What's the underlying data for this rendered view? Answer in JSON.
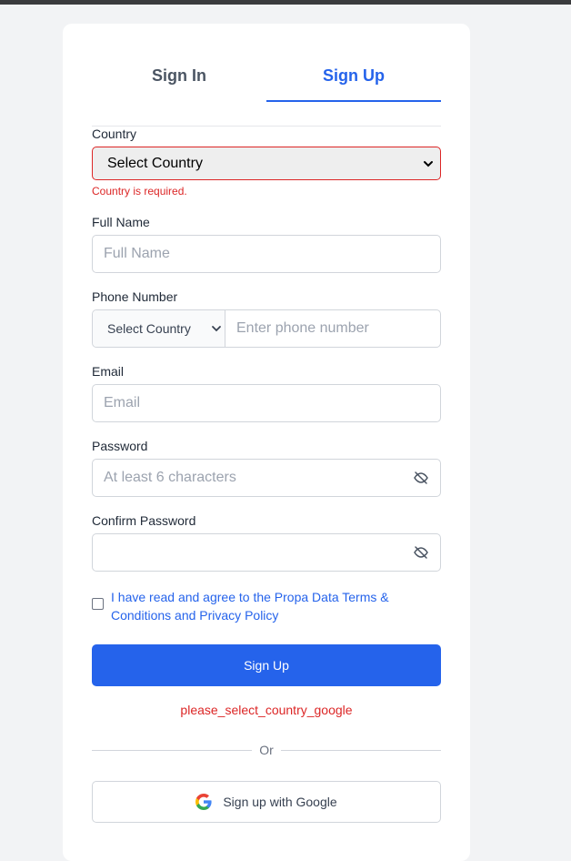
{
  "tabs": [
    {
      "label": "Sign In",
      "active": false
    },
    {
      "label": "Sign Up",
      "active": true
    }
  ],
  "form": {
    "country": {
      "label": "Country",
      "value": "Select Country",
      "error": "Country is required."
    },
    "full_name": {
      "label": "Full Name",
      "placeholder": "Full Name"
    },
    "phone": {
      "label": "Phone Number",
      "country_value": "Select Country",
      "placeholder": "Enter phone number"
    },
    "email": {
      "label": "Email",
      "placeholder": "Email"
    },
    "password": {
      "label": "Password",
      "placeholder": "At least 6 characters"
    },
    "confirm_password": {
      "label": "Confirm Password",
      "placeholder": ""
    },
    "terms": {
      "text": "I have read and agree to the Propa Data Terms & Conditions and Privacy Policy",
      "checked": false
    },
    "submit_label": "Sign Up",
    "google_error": "please_select_country_google",
    "divider_label": "Or",
    "google_label": "Sign up with Google"
  },
  "colors": {
    "accent": "#2563eb",
    "error": "#dc2626"
  },
  "icons": {
    "select": "chevron-down-icon",
    "password": "eye-off-icon",
    "google": "google-logo-icon"
  }
}
